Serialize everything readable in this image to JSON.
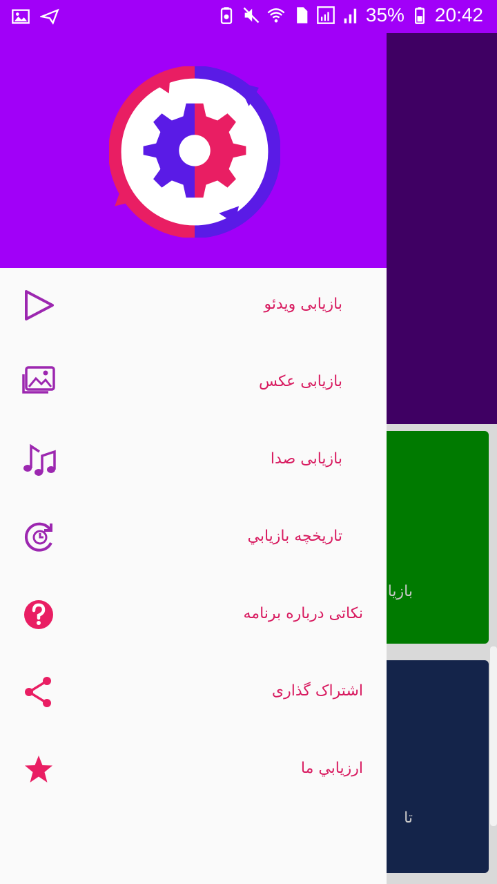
{
  "status_bar": {
    "battery": "35%",
    "time": "20:42"
  },
  "drawer": {
    "items": [
      {
        "label": "بازیابی ویدئو",
        "icon": "play-icon"
      },
      {
        "label": "بازیابی عکس",
        "icon": "gallery-icon"
      },
      {
        "label": "بازیابی صدا",
        "icon": "music-note-icon"
      },
      {
        "label": "تاریخچه بازيابي",
        "icon": "history-icon"
      },
      {
        "label": "نکاتی درباره برنامه",
        "icon": "help-icon"
      },
      {
        "label": "اشتراک گذاری",
        "icon": "share-icon"
      },
      {
        "label": "ارزيابي ما",
        "icon": "star-icon"
      }
    ]
  },
  "background": {
    "card_green_label": "بازیا",
    "card_navy_label": "تا"
  },
  "colors": {
    "primary": "#a100f8",
    "accent_pink": "#e91e63",
    "icon_purple": "#9c27b0",
    "logo_blue": "#5a1be6"
  }
}
